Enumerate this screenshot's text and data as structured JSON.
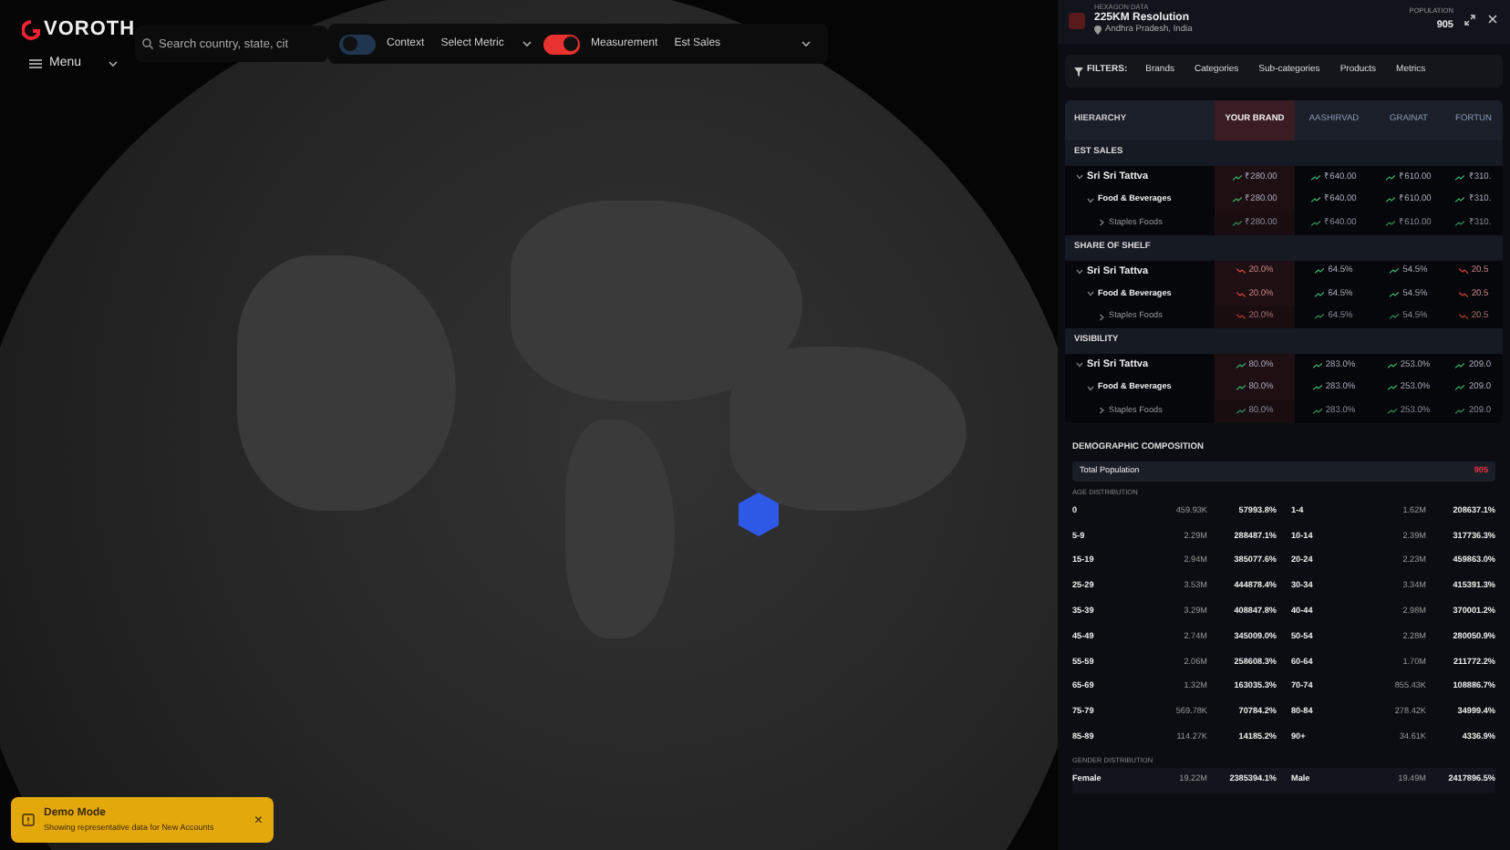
{
  "top_bar": {
    "logo": "VOROTH",
    "menu": "Menu",
    "search": {
      "placeholder": "Search country, state, cit"
    },
    "toggles": [
      {
        "label": "Context",
        "on": false,
        "dropdown": "Select Metric"
      },
      {
        "label": "Measurement",
        "on": true,
        "dropdown": "Est Sales"
      }
    ]
  },
  "toast": {
    "title": "Demo Mode",
    "message": "Showing representative data for New Accounts",
    "close": "×"
  },
  "panel": {
    "header": {
      "eyebrow": "HEXAGON DATA",
      "title": "225KM Resolution",
      "location": "Andhra Pradesh, India",
      "population_label": "POPULATION",
      "population": "905"
    },
    "filters": {
      "label": "FILTERS:",
      "items": [
        "Brands",
        "Categories",
        "Sub-categories",
        "Products",
        "Metrics"
      ]
    },
    "table": {
      "columns": [
        {
          "label": "HIERARCHY",
          "highlighted": false
        },
        {
          "label": "YOUR BRAND",
          "highlighted": true
        },
        {
          "label": "AASHIRVAD",
          "highlighted": false
        },
        {
          "label": "GRAINAT",
          "highlighted": false
        },
        {
          "label": "FORTUN",
          "highlighted": false
        }
      ],
      "sections": [
        {
          "title": "EST SALES",
          "rows": [
            {
              "name": "Sri Sri Tattva",
              "expanded": true,
              "values": [
                {
                  "text": "₹280.00",
                  "up": true
                },
                {
                  "text": "₹640.00",
                  "up": true
                },
                {
                  "text": "₹610.00",
                  "up": true
                },
                {
                  "text": "₹310.",
                  "up": true
                }
              ],
              "children": [
                {
                  "name": "Food & Beverages",
                  "expanded": true,
                  "values": [
                    {
                      "text": "₹280.00",
                      "up": true
                    },
                    {
                      "text": "₹640.00",
                      "up": true
                    },
                    {
                      "text": "₹610.00",
                      "up": true
                    },
                    {
                      "text": "₹310.",
                      "up": true
                    }
                  ],
                  "children": [
                    {
                      "name": "Staples Foods",
                      "expanded": false,
                      "values": [
                        {
                          "text": "₹280.00",
                          "up": true
                        },
                        {
                          "text": "₹640.00",
                          "up": true
                        },
                        {
                          "text": "₹610.00",
                          "up": true
                        },
                        {
                          "text": "₹310.",
                          "up": true
                        }
                      ]
                    }
                  ]
                }
              ]
            }
          ]
        },
        {
          "title": "SHARE OF SHELF",
          "rows": [
            {
              "name": "Sri Sri Tattva",
              "expanded": true,
              "values": [
                {
                  "text": "20.0%",
                  "up": false
                },
                {
                  "text": "64.5%",
                  "up": true
                },
                {
                  "text": "54.5%",
                  "up": true
                },
                {
                  "text": "20.5",
                  "up": false
                }
              ],
              "children": [
                {
                  "name": "Food & Beverages",
                  "expanded": true,
                  "values": [
                    {
                      "text": "20.0%",
                      "up": false
                    },
                    {
                      "text": "64.5%",
                      "up": true
                    },
                    {
                      "text": "54.5%",
                      "up": true
                    },
                    {
                      "text": "20.5",
                      "up": false
                    }
                  ],
                  "children": [
                    {
                      "name": "Staples Foods",
                      "expanded": false,
                      "values": [
                        {
                          "text": "20.0%",
                          "up": false
                        },
                        {
                          "text": "64.5%",
                          "up": true
                        },
                        {
                          "text": "54.5%",
                          "up": true
                        },
                        {
                          "text": "20.5",
                          "up": false
                        }
                      ]
                    }
                  ]
                }
              ]
            }
          ]
        },
        {
          "title": "VISIBILITY",
          "rows": [
            {
              "name": "Sri Sri Tattva",
              "expanded": true,
              "values": [
                {
                  "text": "80.0%",
                  "up": true
                },
                {
                  "text": "283.0%",
                  "up": true
                },
                {
                  "text": "253.0%",
                  "up": true
                },
                {
                  "text": "209.0",
                  "up": true
                }
              ],
              "children": [
                {
                  "name": "Food & Beverages",
                  "expanded": true,
                  "values": [
                    {
                      "text": "80.0%",
                      "up": true
                    },
                    {
                      "text": "283.0%",
                      "up": true
                    },
                    {
                      "text": "253.0%",
                      "up": true
                    },
                    {
                      "text": "209.0",
                      "up": true
                    }
                  ],
                  "children": [
                    {
                      "name": "Staples Foods",
                      "expanded": false,
                      "values": [
                        {
                          "text": "80.0%",
                          "up": true
                        },
                        {
                          "text": "283.0%",
                          "up": true
                        },
                        {
                          "text": "253.0%",
                          "up": true
                        },
                        {
                          "text": "209.0",
                          "up": true
                        }
                      ]
                    }
                  ]
                }
              ]
            }
          ]
        }
      ]
    },
    "demographics": {
      "title": "DEMOGRAPHIC COMPOSITION",
      "total_label": "Total Population",
      "total_value": "905",
      "age_label": "AGE DISTRIBUTION",
      "age_groups": [
        {
          "group": "0",
          "count": "459.93K",
          "share": "57993.8%"
        },
        {
          "group": "1-4",
          "count": "1.62M",
          "share": "208637.1%"
        },
        {
          "group": "5-9",
          "count": "2.29M",
          "share": "288487.1%"
        },
        {
          "group": "10-14",
          "count": "2.39M",
          "share": "317736.3%"
        },
        {
          "group": "15-19",
          "count": "2.94M",
          "share": "385077.6%"
        },
        {
          "group": "20-24",
          "count": "2.23M",
          "share": "459863.0%"
        },
        {
          "group": "25-29",
          "count": "3.53M",
          "share": "444878.4%"
        },
        {
          "group": "30-34",
          "count": "3.34M",
          "share": "415391.3%"
        },
        {
          "group": "35-39",
          "count": "3.29M",
          "share": "408847.8%"
        },
        {
          "group": "40-44",
          "count": "2.98M",
          "share": "370001.2%"
        },
        {
          "group": "45-49",
          "count": "2.74M",
          "share": "345009.0%"
        },
        {
          "group": "50-54",
          "count": "2.28M",
          "share": "280050.9%"
        },
        {
          "group": "55-59",
          "count": "2.06M",
          "share": "258608.3%"
        },
        {
          "group": "60-64",
          "count": "1.70M",
          "share": "211772.2%"
        },
        {
          "group": "65-69",
          "count": "1.32M",
          "share": "163035.3%"
        },
        {
          "group": "70-74",
          "count": "855.43K",
          "share": "108886.7%"
        },
        {
          "group": "75-79",
          "count": "569.78K",
          "share": "70784.2%"
        },
        {
          "group": "80-84",
          "count": "278.42K",
          "share": "34999.4%"
        },
        {
          "group": "85-89",
          "count": "114.27K",
          "share": "14185.2%"
        },
        {
          "group": "90+",
          "count": "34.61K",
          "share": "4336.9%"
        }
      ],
      "gender_label": "GENDER DISTRIBUTION",
      "gender_groups": [
        {
          "group": "Female",
          "count": "19.22M",
          "share": "2385394.1%"
        },
        {
          "group": "Male",
          "count": "19.49M",
          "share": "2417896.5%"
        }
      ]
    }
  }
}
